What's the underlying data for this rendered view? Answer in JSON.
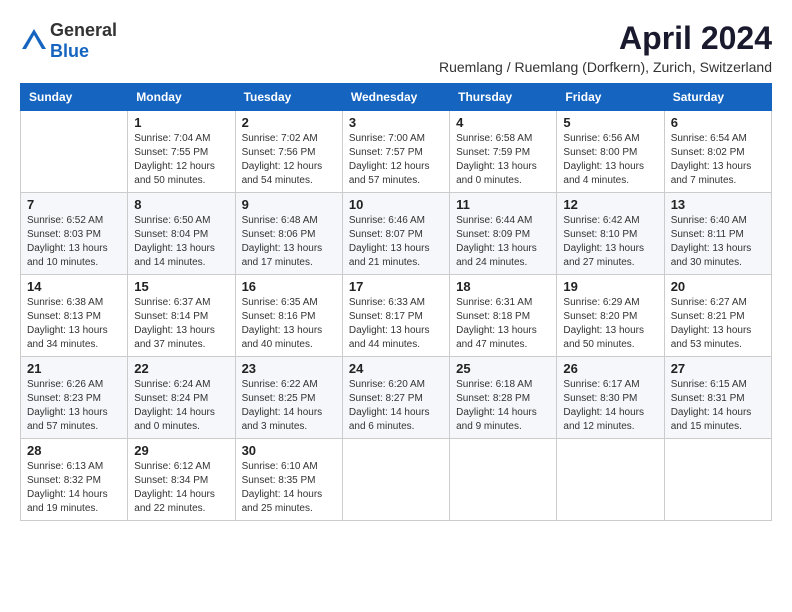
{
  "header": {
    "logo": {
      "general": "General",
      "blue": "Blue"
    },
    "title": "April 2024",
    "location": "Ruemlang / Ruemlang (Dorfkern), Zurich, Switzerland"
  },
  "calendar": {
    "days_of_week": [
      "Sunday",
      "Monday",
      "Tuesday",
      "Wednesday",
      "Thursday",
      "Friday",
      "Saturday"
    ],
    "weeks": [
      [
        {
          "day": "",
          "info": ""
        },
        {
          "day": "1",
          "info": "Sunrise: 7:04 AM\nSunset: 7:55 PM\nDaylight: 12 hours\nand 50 minutes."
        },
        {
          "day": "2",
          "info": "Sunrise: 7:02 AM\nSunset: 7:56 PM\nDaylight: 12 hours\nand 54 minutes."
        },
        {
          "day": "3",
          "info": "Sunrise: 7:00 AM\nSunset: 7:57 PM\nDaylight: 12 hours\nand 57 minutes."
        },
        {
          "day": "4",
          "info": "Sunrise: 6:58 AM\nSunset: 7:59 PM\nDaylight: 13 hours\nand 0 minutes."
        },
        {
          "day": "5",
          "info": "Sunrise: 6:56 AM\nSunset: 8:00 PM\nDaylight: 13 hours\nand 4 minutes."
        },
        {
          "day": "6",
          "info": "Sunrise: 6:54 AM\nSunset: 8:02 PM\nDaylight: 13 hours\nand 7 minutes."
        }
      ],
      [
        {
          "day": "7",
          "info": "Sunrise: 6:52 AM\nSunset: 8:03 PM\nDaylight: 13 hours\nand 10 minutes."
        },
        {
          "day": "8",
          "info": "Sunrise: 6:50 AM\nSunset: 8:04 PM\nDaylight: 13 hours\nand 14 minutes."
        },
        {
          "day": "9",
          "info": "Sunrise: 6:48 AM\nSunset: 8:06 PM\nDaylight: 13 hours\nand 17 minutes."
        },
        {
          "day": "10",
          "info": "Sunrise: 6:46 AM\nSunset: 8:07 PM\nDaylight: 13 hours\nand 21 minutes."
        },
        {
          "day": "11",
          "info": "Sunrise: 6:44 AM\nSunset: 8:09 PM\nDaylight: 13 hours\nand 24 minutes."
        },
        {
          "day": "12",
          "info": "Sunrise: 6:42 AM\nSunset: 8:10 PM\nDaylight: 13 hours\nand 27 minutes."
        },
        {
          "day": "13",
          "info": "Sunrise: 6:40 AM\nSunset: 8:11 PM\nDaylight: 13 hours\nand 30 minutes."
        }
      ],
      [
        {
          "day": "14",
          "info": "Sunrise: 6:38 AM\nSunset: 8:13 PM\nDaylight: 13 hours\nand 34 minutes."
        },
        {
          "day": "15",
          "info": "Sunrise: 6:37 AM\nSunset: 8:14 PM\nDaylight: 13 hours\nand 37 minutes."
        },
        {
          "day": "16",
          "info": "Sunrise: 6:35 AM\nSunset: 8:16 PM\nDaylight: 13 hours\nand 40 minutes."
        },
        {
          "day": "17",
          "info": "Sunrise: 6:33 AM\nSunset: 8:17 PM\nDaylight: 13 hours\nand 44 minutes."
        },
        {
          "day": "18",
          "info": "Sunrise: 6:31 AM\nSunset: 8:18 PM\nDaylight: 13 hours\nand 47 minutes."
        },
        {
          "day": "19",
          "info": "Sunrise: 6:29 AM\nSunset: 8:20 PM\nDaylight: 13 hours\nand 50 minutes."
        },
        {
          "day": "20",
          "info": "Sunrise: 6:27 AM\nSunset: 8:21 PM\nDaylight: 13 hours\nand 53 minutes."
        }
      ],
      [
        {
          "day": "21",
          "info": "Sunrise: 6:26 AM\nSunset: 8:23 PM\nDaylight: 13 hours\nand 57 minutes."
        },
        {
          "day": "22",
          "info": "Sunrise: 6:24 AM\nSunset: 8:24 PM\nDaylight: 14 hours\nand 0 minutes."
        },
        {
          "day": "23",
          "info": "Sunrise: 6:22 AM\nSunset: 8:25 PM\nDaylight: 14 hours\nand 3 minutes."
        },
        {
          "day": "24",
          "info": "Sunrise: 6:20 AM\nSunset: 8:27 PM\nDaylight: 14 hours\nand 6 minutes."
        },
        {
          "day": "25",
          "info": "Sunrise: 6:18 AM\nSunset: 8:28 PM\nDaylight: 14 hours\nand 9 minutes."
        },
        {
          "day": "26",
          "info": "Sunrise: 6:17 AM\nSunset: 8:30 PM\nDaylight: 14 hours\nand 12 minutes."
        },
        {
          "day": "27",
          "info": "Sunrise: 6:15 AM\nSunset: 8:31 PM\nDaylight: 14 hours\nand 15 minutes."
        }
      ],
      [
        {
          "day": "28",
          "info": "Sunrise: 6:13 AM\nSunset: 8:32 PM\nDaylight: 14 hours\nand 19 minutes."
        },
        {
          "day": "29",
          "info": "Sunrise: 6:12 AM\nSunset: 8:34 PM\nDaylight: 14 hours\nand 22 minutes."
        },
        {
          "day": "30",
          "info": "Sunrise: 6:10 AM\nSunset: 8:35 PM\nDaylight: 14 hours\nand 25 minutes."
        },
        {
          "day": "",
          "info": ""
        },
        {
          "day": "",
          "info": ""
        },
        {
          "day": "",
          "info": ""
        },
        {
          "day": "",
          "info": ""
        }
      ]
    ]
  }
}
